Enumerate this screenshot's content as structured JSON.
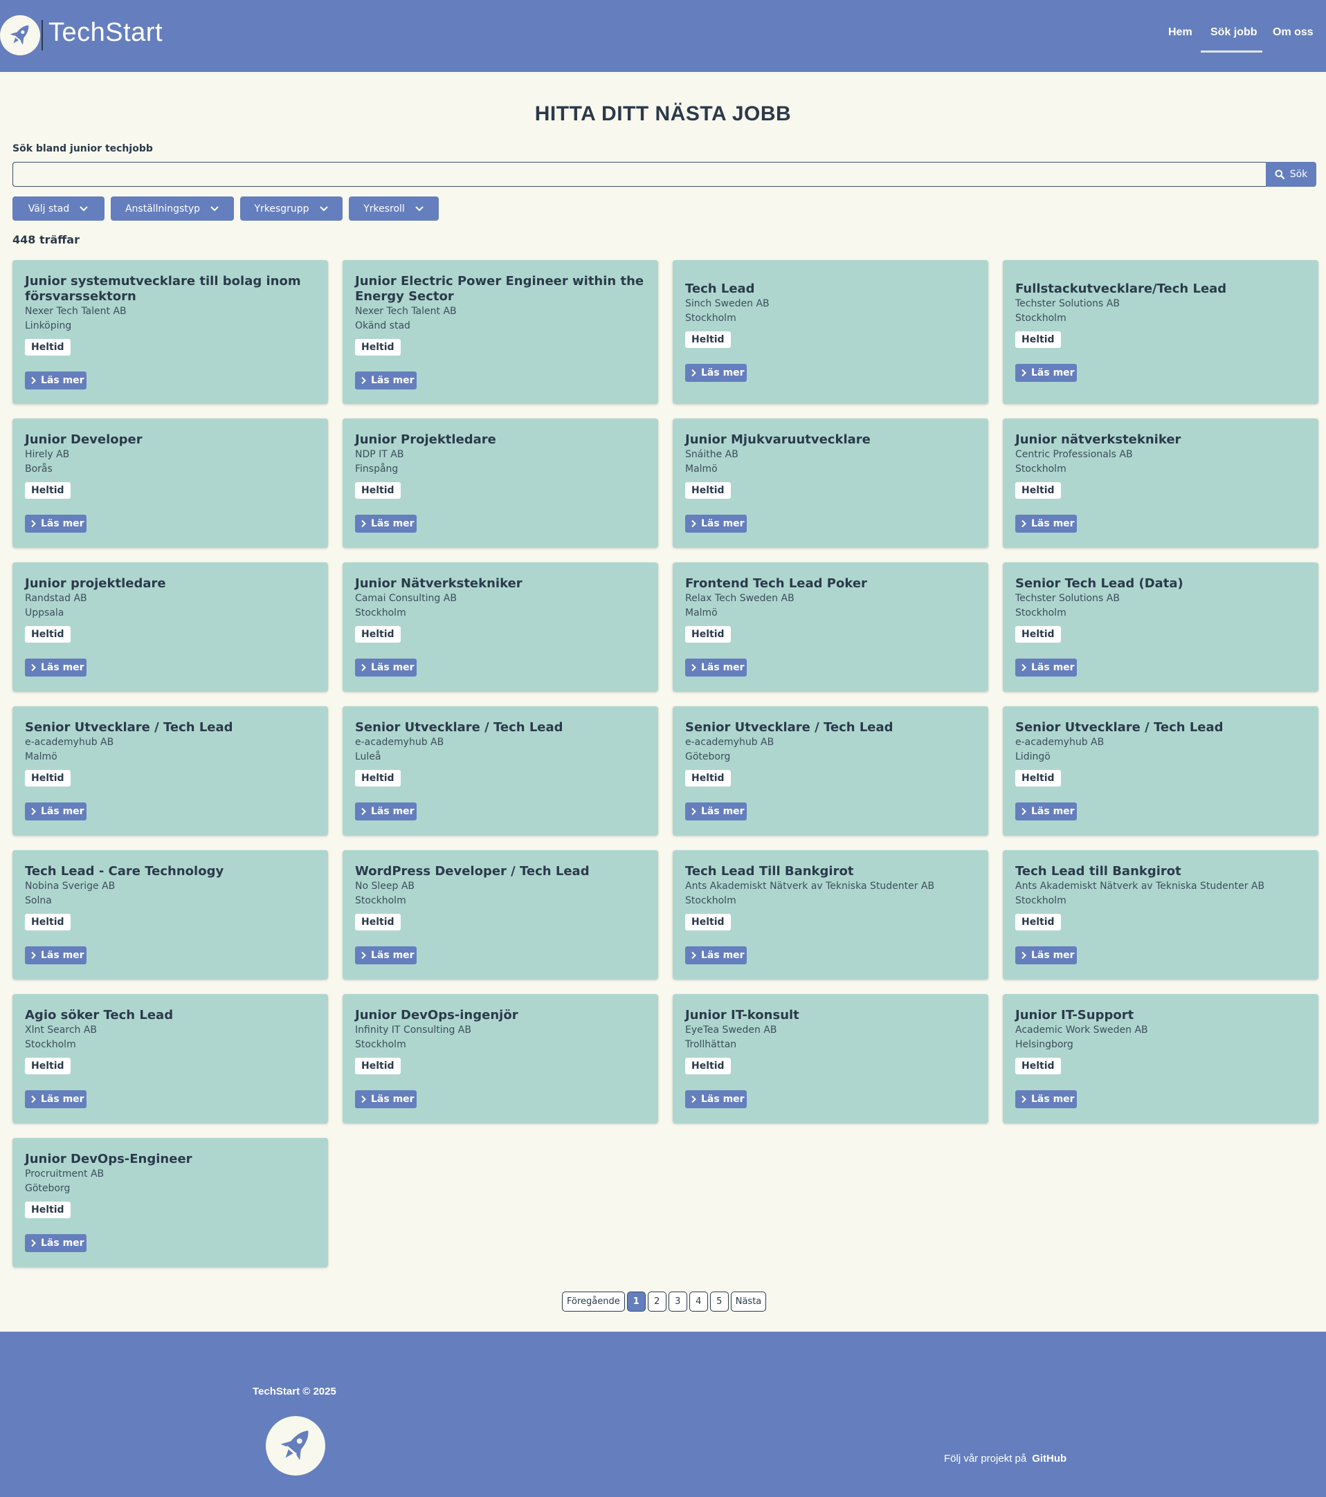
{
  "header": {
    "brand": "TechStart",
    "nav": [
      "Hem",
      "Sök jobb",
      "Om oss"
    ]
  },
  "main": {
    "title": "HITTA DITT NÄSTA JOBB",
    "search_label": "Sök bland junior techjobb",
    "search_value": "",
    "search_button": "Sök",
    "filters": [
      "Välj stad",
      "Anställningstyp",
      "Yrkesgrupp",
      "Yrkesroll"
    ],
    "hits": "448 träffar",
    "read_more": "Läs mer",
    "jobs": [
      {
        "title": "Junior systemutvecklare till bolag inom försvarssektorn",
        "company": "Nexer Tech Talent AB",
        "city": "Linköping",
        "type": "Heltid"
      },
      {
        "title": "Junior Electric Power Engineer within the Energy Sector",
        "company": "Nexer Tech Talent AB",
        "city": "Okänd stad",
        "type": "Heltid"
      },
      {
        "title": "Tech Lead",
        "company": "Sinch Sweden AB",
        "city": "Stockholm",
        "type": "Heltid"
      },
      {
        "title": "Fullstackutvecklare/Tech Lead",
        "company": "Techster Solutions AB",
        "city": "Stockholm",
        "type": "Heltid"
      },
      {
        "title": "Junior Developer",
        "company": "Hirely AB",
        "city": "Borås",
        "type": "Heltid"
      },
      {
        "title": "Junior Projektledare",
        "company": "NDP IT AB",
        "city": "Finspång",
        "type": "Heltid"
      },
      {
        "title": "Junior Mjukvaruutvecklare",
        "company": "Snáithe AB",
        "city": "Malmö",
        "type": "Heltid"
      },
      {
        "title": "Junior nätverkstekniker",
        "company": "Centric Professionals AB",
        "city": "Stockholm",
        "type": "Heltid"
      },
      {
        "title": "Junior projektledare",
        "company": "Randstad AB",
        "city": "Uppsala",
        "type": "Heltid"
      },
      {
        "title": "Junior Nätverkstekniker",
        "company": "Camai Consulting AB",
        "city": "Stockholm",
        "type": "Heltid"
      },
      {
        "title": "Frontend Tech Lead Poker",
        "company": "Relax Tech Sweden AB",
        "city": "Malmö",
        "type": "Heltid"
      },
      {
        "title": "Senior Tech Lead (Data)",
        "company": "Techster Solutions AB",
        "city": "Stockholm",
        "type": "Heltid"
      },
      {
        "title": "Senior Utvecklare / Tech Lead",
        "company": "e-academyhub AB",
        "city": "Malmö",
        "type": "Heltid"
      },
      {
        "title": "Senior Utvecklare / Tech Lead",
        "company": "e-academyhub AB",
        "city": "Luleå",
        "type": "Heltid"
      },
      {
        "title": "Senior Utvecklare / Tech Lead",
        "company": "e-academyhub AB",
        "city": "Göteborg",
        "type": "Heltid"
      },
      {
        "title": "Senior Utvecklare / Tech Lead",
        "company": "e-academyhub AB",
        "city": "Lidingö",
        "type": "Heltid"
      },
      {
        "title": "Tech Lead - Care Technology",
        "company": "Nobina Sverige AB",
        "city": "Solna",
        "type": "Heltid"
      },
      {
        "title": "WordPress Developer / Tech Lead",
        "company": "No Sleep AB",
        "city": "Stockholm",
        "type": "Heltid"
      },
      {
        "title": "Tech Lead Till Bankgirot",
        "company": "Ants Akademiskt Nätverk av Tekniska Studenter AB",
        "city": "Stockholm",
        "type": "Heltid"
      },
      {
        "title": "Tech Lead till Bankgirot",
        "company": "Ants Akademiskt Nätverk av Tekniska Studenter AB",
        "city": "Stockholm",
        "type": "Heltid"
      },
      {
        "title": "Agio söker Tech Lead",
        "company": "Xlnt Search AB",
        "city": "Stockholm",
        "type": "Heltid"
      },
      {
        "title": "Junior DevOps-ingenjör",
        "company": "Infinity IT Consulting AB",
        "city": "Stockholm",
        "type": "Heltid"
      },
      {
        "title": "Junior IT-konsult",
        "company": "EyeTea Sweden AB",
        "city": "Trollhättan",
        "type": "Heltid"
      },
      {
        "title": "Junior IT-Support",
        "company": "Academic Work Sweden AB",
        "city": "Helsingborg",
        "type": "Heltid"
      },
      {
        "title": "Junior DevOps-Engineer",
        "company": "Procruitment AB",
        "city": "Göteborg",
        "type": "Heltid"
      }
    ]
  },
  "pagination": {
    "prev": "Föregående",
    "pages": [
      "1",
      "2",
      "3",
      "4",
      "5"
    ],
    "current": "1",
    "next": "Nästa"
  },
  "footer": {
    "copyright": "TechStart © 2025",
    "follow_text": "Följ vår projekt på",
    "github": "GitHub"
  },
  "colors": {
    "primary": "#657ebd",
    "card": "#aed6cf",
    "background": "#f8f8ee",
    "text": "#2b3a4a"
  },
  "icons": [
    "rocket-icon",
    "search-icon",
    "chevron-down-icon",
    "chevron-right-icon"
  ]
}
